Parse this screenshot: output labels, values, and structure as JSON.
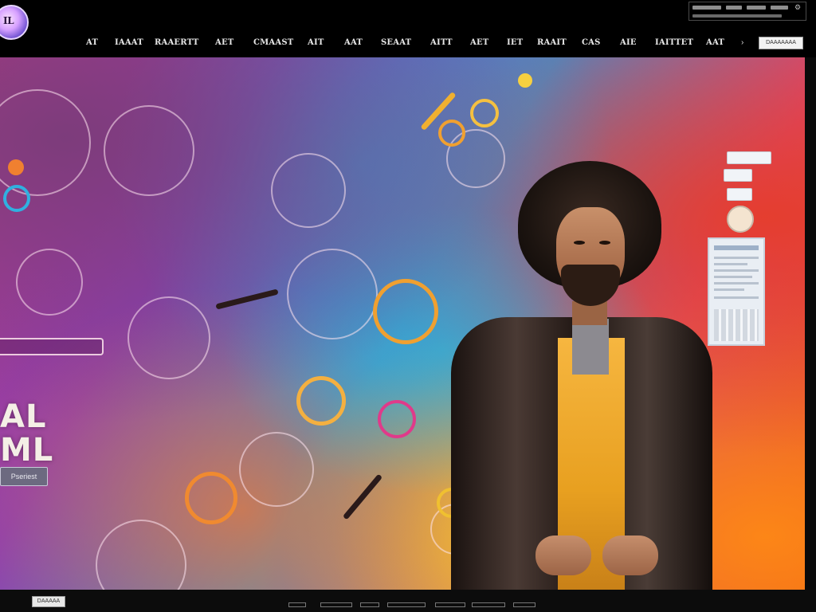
{
  "header": {
    "logo_text": "IL",
    "nav": [
      {
        "label": "AT"
      },
      {
        "label": "IAAAT"
      },
      {
        "label": "RAAERTT"
      },
      {
        "label": "AET"
      },
      {
        "label": "CMAAST"
      },
      {
        "label": "AIT"
      },
      {
        "label": "AAT"
      },
      {
        "label": "SEAAT"
      },
      {
        "label": "AITT"
      },
      {
        "label": "AET"
      },
      {
        "label": "IET"
      },
      {
        "label": "RAAIT"
      },
      {
        "label": "CAS"
      },
      {
        "label": "AIE"
      },
      {
        "label": "IAITTET"
      },
      {
        "label": "AAT"
      }
    ],
    "nav_button": "DAAAAAAA"
  },
  "hero": {
    "big_text": "AL\nML",
    "small_button": "Pseriest"
  },
  "footer": {
    "button": "DAAAAA"
  },
  "colors": {
    "header_bg": "#000000",
    "accent_magenta": "#b83a8a",
    "accent_orange": "#e8501c",
    "vest_yellow": "#f6b640"
  },
  "icons": {
    "logo": "circular-logo-icon",
    "chevron": "chevron-icon",
    "utility": "settings-icon"
  }
}
